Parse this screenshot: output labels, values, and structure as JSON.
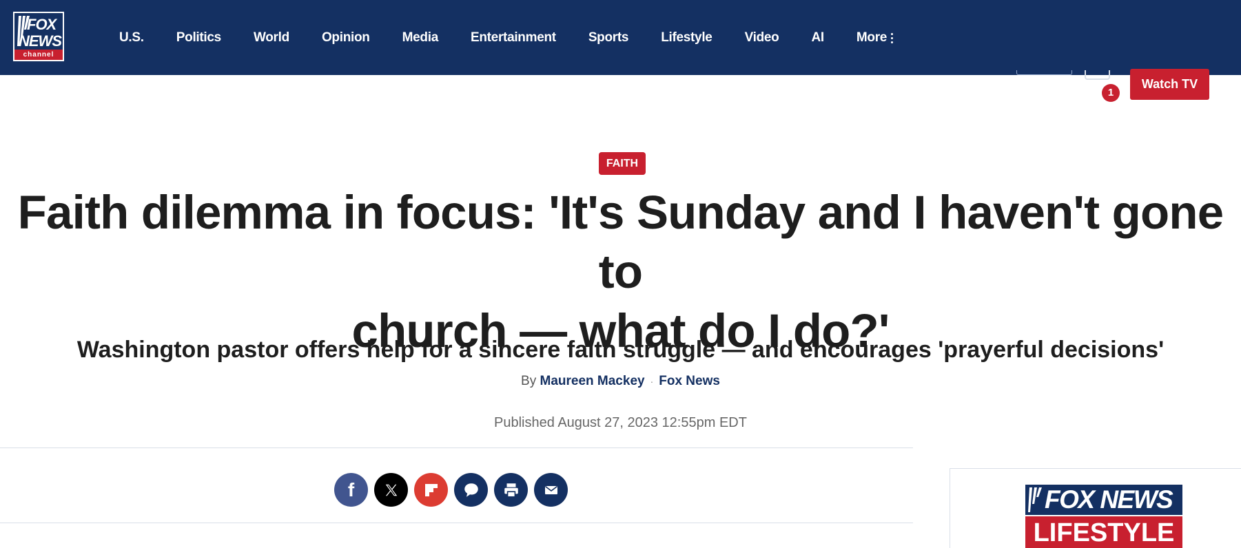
{
  "header": {
    "logo": {
      "fox": "FOX",
      "news": "NEWS",
      "channel": "channel"
    },
    "nav": [
      {
        "label": "U.S."
      },
      {
        "label": "Politics"
      },
      {
        "label": "World"
      },
      {
        "label": "Opinion"
      },
      {
        "label": "Media"
      },
      {
        "label": "Entertainment"
      },
      {
        "label": "Sports"
      },
      {
        "label": "Lifestyle"
      },
      {
        "label": "Video"
      },
      {
        "label": "AI"
      },
      {
        "label": "More"
      }
    ],
    "more_icon": "kebab-vertical-icon",
    "notification_count": "1",
    "watch_tv_label": "Watch TV"
  },
  "article": {
    "category": "FAITH",
    "headline_line1": "Faith dilemma in focus: 'It's Sunday and I haven't gone to",
    "headline_line2": "church — what do I do?'",
    "subheadline": "Washington pastor offers help for a sincere faith struggle — and encourages 'prayerful decisions'",
    "byline_prefix": "By",
    "author": "Maureen Mackey",
    "outlet": "Fox News",
    "published": "Published August 27, 2023 12:55pm EDT"
  },
  "share": [
    {
      "name": "facebook-icon",
      "glyph": "f"
    },
    {
      "name": "x-icon",
      "glyph": "𝕏"
    },
    {
      "name": "flipboard-icon",
      "glyph": ""
    },
    {
      "name": "comments-icon",
      "glyph": ""
    },
    {
      "name": "print-icon",
      "glyph": ""
    },
    {
      "name": "email-icon",
      "glyph": ""
    }
  ],
  "rail": {
    "logo_top": "FOX NEWS",
    "logo_bottom": "LIFESTYLE"
  },
  "colors": {
    "nav_bg": "#143062",
    "accent_red": "#c8202f",
    "link_navy": "#143062",
    "facebook": "#41558f",
    "flipboard": "#dc3c32"
  }
}
